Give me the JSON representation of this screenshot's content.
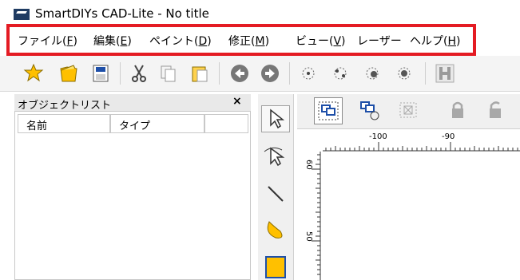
{
  "window": {
    "title": "SmartDIYs CAD-Lite  - No title"
  },
  "menu": [
    {
      "label": "ファイル(",
      "accel": "F",
      "tail": ")"
    },
    {
      "label": "編集(",
      "accel": "E",
      "tail": ")"
    },
    {
      "label": "ペイント(",
      "accel": "D",
      "tail": ")"
    },
    {
      "label": "修正(",
      "accel": "M",
      "tail": ")"
    },
    {
      "label": "ビュー(",
      "accel": "V",
      "tail": ")"
    },
    {
      "label": "レーザー",
      "accel": "",
      "tail": ""
    },
    {
      "label": "ヘルプ(",
      "accel": "H",
      "tail": ")"
    }
  ],
  "toolbar_icons": [
    "new-icon",
    "open-icon",
    "save-icon",
    "cut-icon",
    "copy-icon",
    "paste-icon",
    "undo-icon",
    "redo-icon",
    "point-icon",
    "point-select-icon",
    "point-move-icon",
    "point-delete-icon",
    "h-icon"
  ],
  "object_panel": {
    "title": "オブジェクトリスト",
    "close": "×",
    "columns": [
      "名前",
      "タイプ"
    ]
  },
  "draw_tools": [
    "select-arrow-icon",
    "node-edit-icon",
    "line-tool-icon",
    "freeform-tool-icon",
    "rectangle-tool-icon"
  ],
  "ruler": {
    "top_labels": [
      "-100",
      "-90"
    ],
    "left_labels": [
      "60",
      "50"
    ]
  },
  "colors": {
    "accent_outline": "#e41b23",
    "icon_yellow": "#ffc000",
    "icon_blue": "#1e4fa8"
  }
}
